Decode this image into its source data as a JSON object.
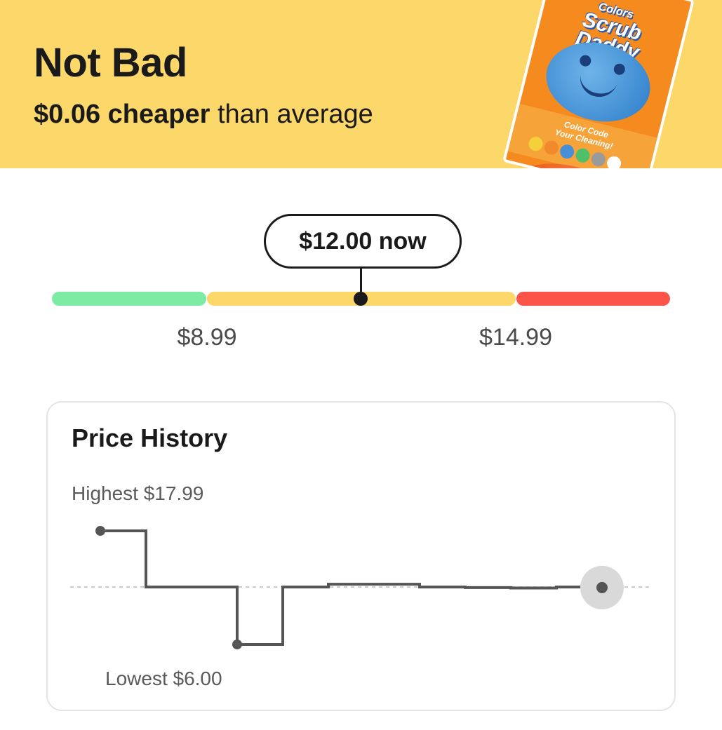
{
  "banner": {
    "verdict": "Not Bad",
    "savings_amount": "$0.06 cheaper",
    "savings_suffix": " than average",
    "background_color": "#fcd76a",
    "product": {
      "brand_line1": "Colors",
      "brand_line2": "Scrub",
      "brand_line3": "Daddy",
      "stripe_line1": "Color Code",
      "stripe_line2": "Your Cleaning!"
    }
  },
  "price_range": {
    "current_label": "$12.00 now",
    "current_price": 12.0,
    "low_threshold_label": "$8.99",
    "high_threshold_label": "$14.99",
    "colors": {
      "low": "#7eeba5",
      "mid": "#fcd76a",
      "high": "#fd5449"
    }
  },
  "price_history": {
    "title": "Price History",
    "highest_label": "Highest $17.99",
    "lowest_label": "Lowest $6.00",
    "chart_data": {
      "type": "line",
      "step": true,
      "x": [
        1,
        2,
        3,
        4,
        5,
        6,
        7,
        8,
        9,
        10,
        11,
        12
      ],
      "y": [
        17.99,
        12.06,
        12.06,
        6.0,
        12.06,
        12.36,
        12.36,
        12.06,
        12.0,
        11.96,
        12.06,
        12.0
      ],
      "ylim": [
        6.0,
        17.99
      ],
      "average": 12.06,
      "highlight_last_point": true,
      "grid": false
    }
  }
}
